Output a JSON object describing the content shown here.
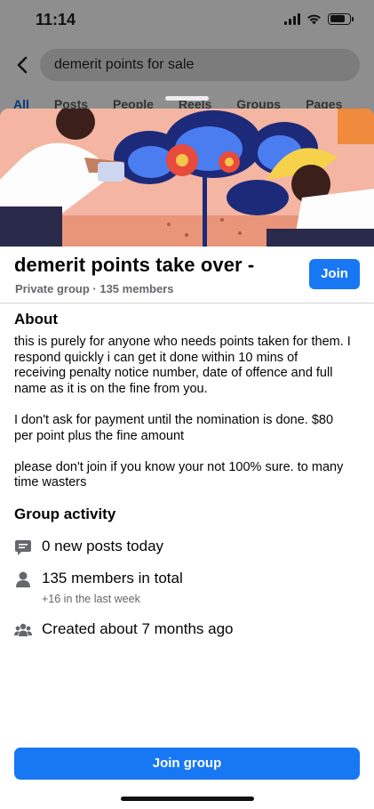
{
  "status": {
    "time": "11:14",
    "battery_level": 0.8
  },
  "search": {
    "query": "demerit points for sale"
  },
  "tabs": [
    {
      "label": "All"
    },
    {
      "label": "Posts"
    },
    {
      "label": "People"
    },
    {
      "label": "Reels"
    },
    {
      "label": "Groups"
    },
    {
      "label": "Pages"
    }
  ],
  "group": {
    "title": "demerit points take over -",
    "meta": "Private group · 135 members",
    "join_label": "Join"
  },
  "about": {
    "heading": "About",
    "paragraphs": [
      "this is purely for anyone who needs points taken for them.    I respond quickly i can get it done within 10 mins of receiving penalty notice number, date of offence and full name as it is on the fine from you.",
      "I don't ask for payment until the nomination is done. $80 per point plus the fine amount",
      "please don't join if you know your not 100% sure. to many time wasters"
    ]
  },
  "activity": {
    "heading": "Group activity",
    "posts_today": "0 new posts today",
    "members_total": "135 members in total",
    "members_sub": "+16 in the last week",
    "created": "Created about 7 months ago"
  },
  "footer": {
    "join_group_label": "Join group"
  },
  "colors": {
    "accent": "#1877f2"
  }
}
